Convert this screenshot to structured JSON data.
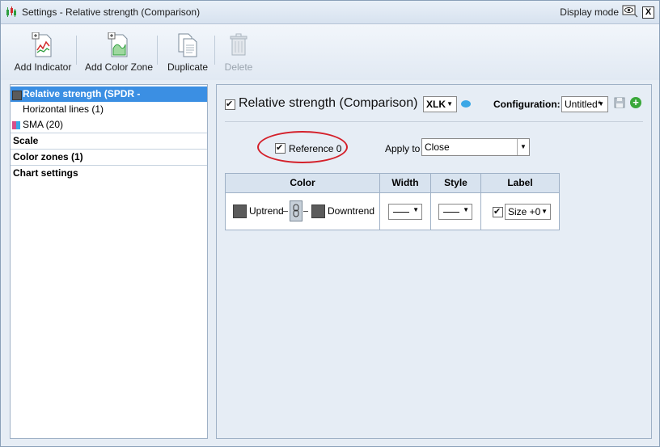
{
  "window": {
    "title": "Settings - Relative strength (Comparison)",
    "display_mode_label": "Display mode",
    "close_glyph": "X"
  },
  "toolbar": {
    "add_indicator": "Add Indicator",
    "add_color_zone": "Add Color Zone",
    "duplicate": "Duplicate",
    "delete": "Delete"
  },
  "tree": {
    "items": [
      {
        "label": "Relative strength (SPDR - TECHNOLOGY)",
        "swatch": "#5b5b5b"
      },
      {
        "label": "Horizontal lines (1)"
      },
      {
        "label": "SMA (20)",
        "swatch": "#d64f8a"
      }
    ],
    "sections": [
      "Scale",
      "Color zones (1)",
      "Chart settings"
    ]
  },
  "indicator": {
    "title": "Relative strength (Comparison)",
    "symbol": "XLK",
    "configuration_label": "Configuration:",
    "configuration_value": "Untitled*"
  },
  "reference": {
    "label": "Reference 0",
    "apply_to_label": "Apply to",
    "apply_to_value": "Close"
  },
  "grid": {
    "headers": {
      "color": "Color",
      "width": "Width",
      "style": "Style",
      "label": "Label"
    },
    "uptrend_label": "Uptrend",
    "downtrend_label": "Downtrend",
    "size_value": "Size +0"
  },
  "colors": {
    "accent": "#3b8fe3",
    "highlight_ellipse": "#d4202a",
    "trend_swatch": "#5b5b5b"
  }
}
